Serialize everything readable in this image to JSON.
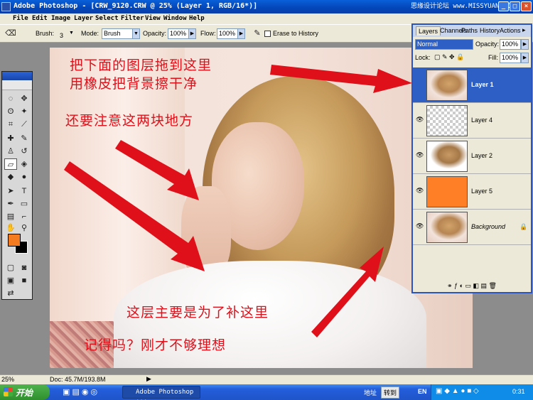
{
  "window": {
    "title": "Adobe Photoshop - [CRW_9120.CRW @ 25% (Layer 1, RGB/16*)]",
    "watermark": "思缘设计论坛  www.MISSYUAN.COM"
  },
  "menu": [
    "File",
    "Edit",
    "Image",
    "Layer",
    "Select",
    "Filter",
    "View",
    "Window",
    "Help"
  ],
  "options": {
    "brush_label": "Brush:",
    "brush_size": "3",
    "mode_label": "Mode:",
    "mode_value": "Brush",
    "opacity_label": "Opacity:",
    "opacity_value": "100%",
    "flow_label": "Flow:",
    "flow_value": "100%",
    "erase_to_history": "Erase to History"
  },
  "annotations": {
    "line1": "把下面的图层拖到这里",
    "line2": "用橡皮把背景擦干净",
    "line3": "还要注意这两块地方",
    "line4": "这层主要是为了补这里",
    "line5": "记得吗？刚才不够理想"
  },
  "layers_panel": {
    "tabs": [
      "Layers",
      "Channels",
      "Paths",
      "History",
      "Actions"
    ],
    "blend_mode": "Normal",
    "opacity_label": "Opacity:",
    "opacity_value": "100%",
    "lock_label": "Lock:",
    "fill_label": "Fill:",
    "fill_value": "100%",
    "layers": [
      {
        "name": "Layer 1",
        "selected": true
      },
      {
        "name": "Layer 4",
        "selected": false
      },
      {
        "name": "Layer 2",
        "selected": false
      },
      {
        "name": "Layer 5",
        "selected": false
      },
      {
        "name": "Background",
        "selected": false
      }
    ]
  },
  "status": {
    "zoom": "25%",
    "doc": "Doc: 45.7M/193.8M"
  },
  "taskbar": {
    "start": "开始",
    "task": "Adobe Photoshop ...",
    "address_label": "地址",
    "go": "转到",
    "ime": "EN",
    "time": "0:31"
  },
  "colors": {
    "foreground": "#f47b20",
    "background": "#000000",
    "annotation": "#e0101a",
    "layer5_fill": "#ff7f27"
  }
}
